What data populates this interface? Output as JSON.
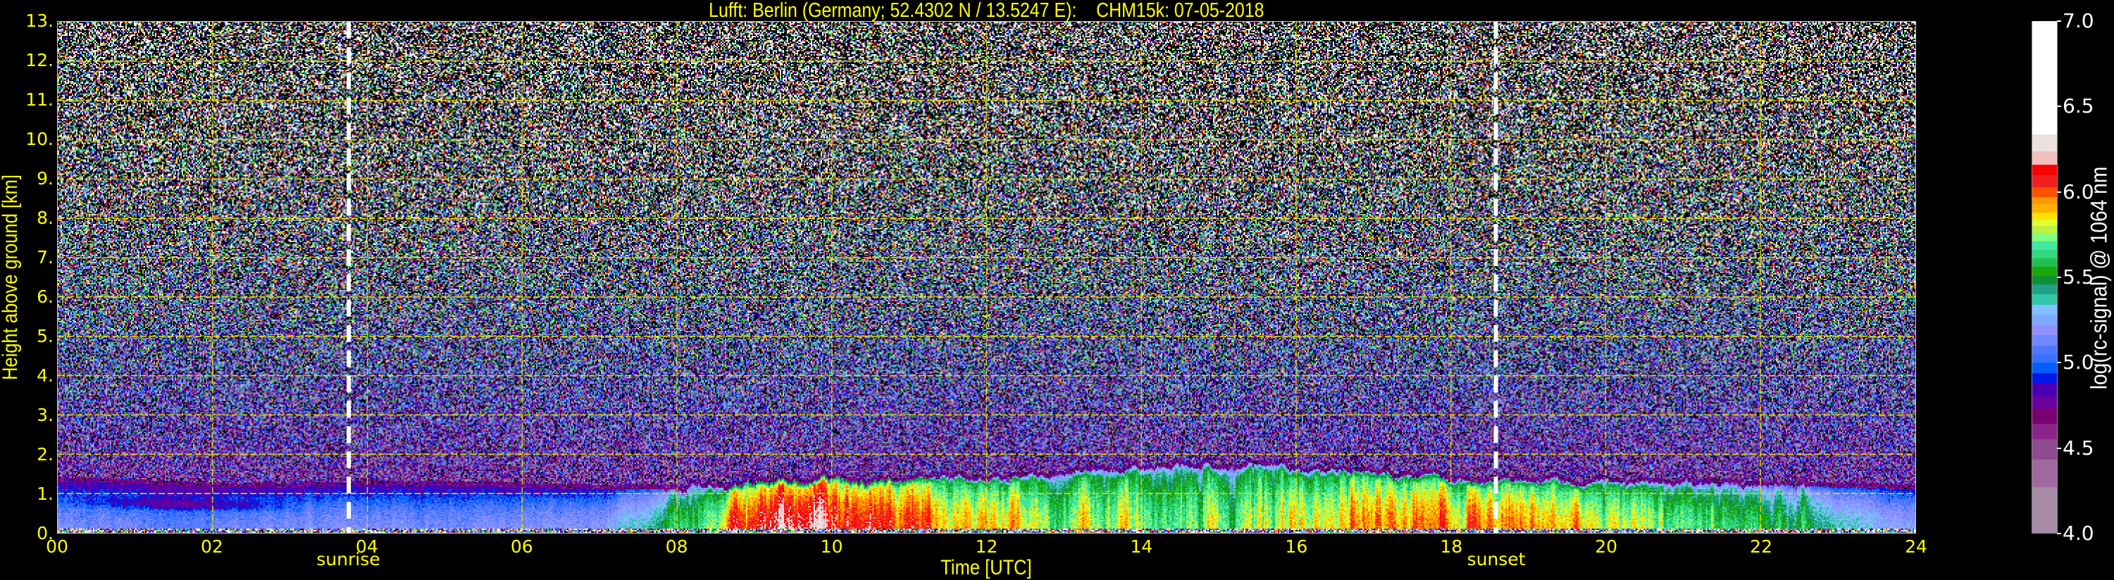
{
  "chart_data": {
    "type": "heatmap",
    "title": "Lufft: Berlin (Germany; 52.4302 N / 13.5247 E):    CHM15k: 07-05-2018",
    "xlabel": "Time [UTC]",
    "ylabel": "Height above ground [km]",
    "xlim": [
      0,
      24
    ],
    "ylim": [
      0,
      13
    ],
    "grid": true,
    "x_tick_values": [
      0,
      2,
      4,
      6,
      8,
      10,
      12,
      14,
      16,
      18,
      20,
      22,
      24
    ],
    "x_ticks": [
      "00",
      "02",
      "04",
      "06",
      "08",
      "10",
      "12",
      "14",
      "16",
      "18",
      "20",
      "22",
      "24"
    ],
    "y_tick_values": [
      0,
      1,
      2,
      3,
      4,
      5,
      6,
      7,
      8,
      9,
      10,
      11,
      12,
      13
    ],
    "y_ticks": [
      "0.",
      "1.",
      "2.",
      "3.",
      "4.",
      "5.",
      "6.",
      "7.",
      "8.",
      "9.",
      "10.",
      "11.",
      "12.",
      "13."
    ],
    "annotations": [
      {
        "label": "sunrise",
        "time_utc_hours": 3.76
      },
      {
        "label": "sunset",
        "time_utc_hours": 18.58
      }
    ],
    "colorbar": {
      "label": "log(rc-signal) @ 1064 nm",
      "range": [
        4.0,
        7.0
      ],
      "tick_values": [
        4.0,
        4.5,
        5.0,
        5.5,
        6.0,
        6.5,
        7.0
      ],
      "ticks": [
        "4.0",
        "4.5",
        "5.0",
        "5.5",
        "6.0",
        "6.5",
        "7.0"
      ],
      "levels": [
        4.0,
        4.27,
        4.43,
        4.55,
        4.64,
        4.73,
        4.8,
        4.88,
        4.94,
        5.0,
        5.05,
        5.1,
        5.16,
        5.22,
        5.28,
        5.34,
        5.4,
        5.46,
        5.51,
        5.56,
        5.61,
        5.66,
        5.71,
        5.76,
        5.8,
        5.84,
        5.88,
        5.93,
        5.97,
        6.03,
        6.1,
        6.16,
        6.24,
        6.34,
        7.0
      ],
      "colors": [
        "#a78ba7",
        "#a06aa0",
        "#904a90",
        "#882488",
        "#780070",
        "#6a00a0",
        "#4a00b0",
        "#0018e8",
        "#0060ff",
        "#3a70ff",
        "#5078ff",
        "#7088ff",
        "#9090ff",
        "#80a8ff",
        "#80c0ff",
        "#30c8a8",
        "#20a088",
        "#109030",
        "#18a808",
        "#20c050",
        "#30d880",
        "#40e8a0",
        "#80ff80",
        "#c0f040",
        "#e0ff30",
        "#ffe000",
        "#ffb000",
        "#ff9800",
        "#ff5000",
        "#f02020",
        "#ff0000",
        "#f0c0c0",
        "#ece0e0",
        "#ffffff"
      ]
    },
    "boundary_layer": {
      "hours": [
        0,
        1,
        2,
        3,
        4,
        5,
        6,
        7,
        8,
        9,
        10,
        11,
        12,
        13,
        14,
        15,
        16,
        17,
        18,
        19,
        20,
        21,
        22,
        23,
        24
      ],
      "top_km": [
        1.3,
        1.25,
        1.15,
        1.15,
        1.2,
        1.2,
        1.15,
        1.1,
        1.1,
        1.25,
        1.35,
        1.4,
        1.35,
        1.5,
        1.65,
        1.7,
        1.65,
        1.55,
        1.35,
        1.25,
        1.3,
        1.25,
        1.2,
        1.15,
        1.1
      ],
      "near_surface_value": [
        5.15,
        5.1,
        5.1,
        5.15,
        5.15,
        5.15,
        5.15,
        5.2,
        5.5,
        6.1,
        6.15,
        6.05,
        5.9,
        5.78,
        5.7,
        5.72,
        5.82,
        5.88,
        5.92,
        5.9,
        5.8,
        5.75,
        5.6,
        5.35,
        5.25
      ]
    }
  }
}
